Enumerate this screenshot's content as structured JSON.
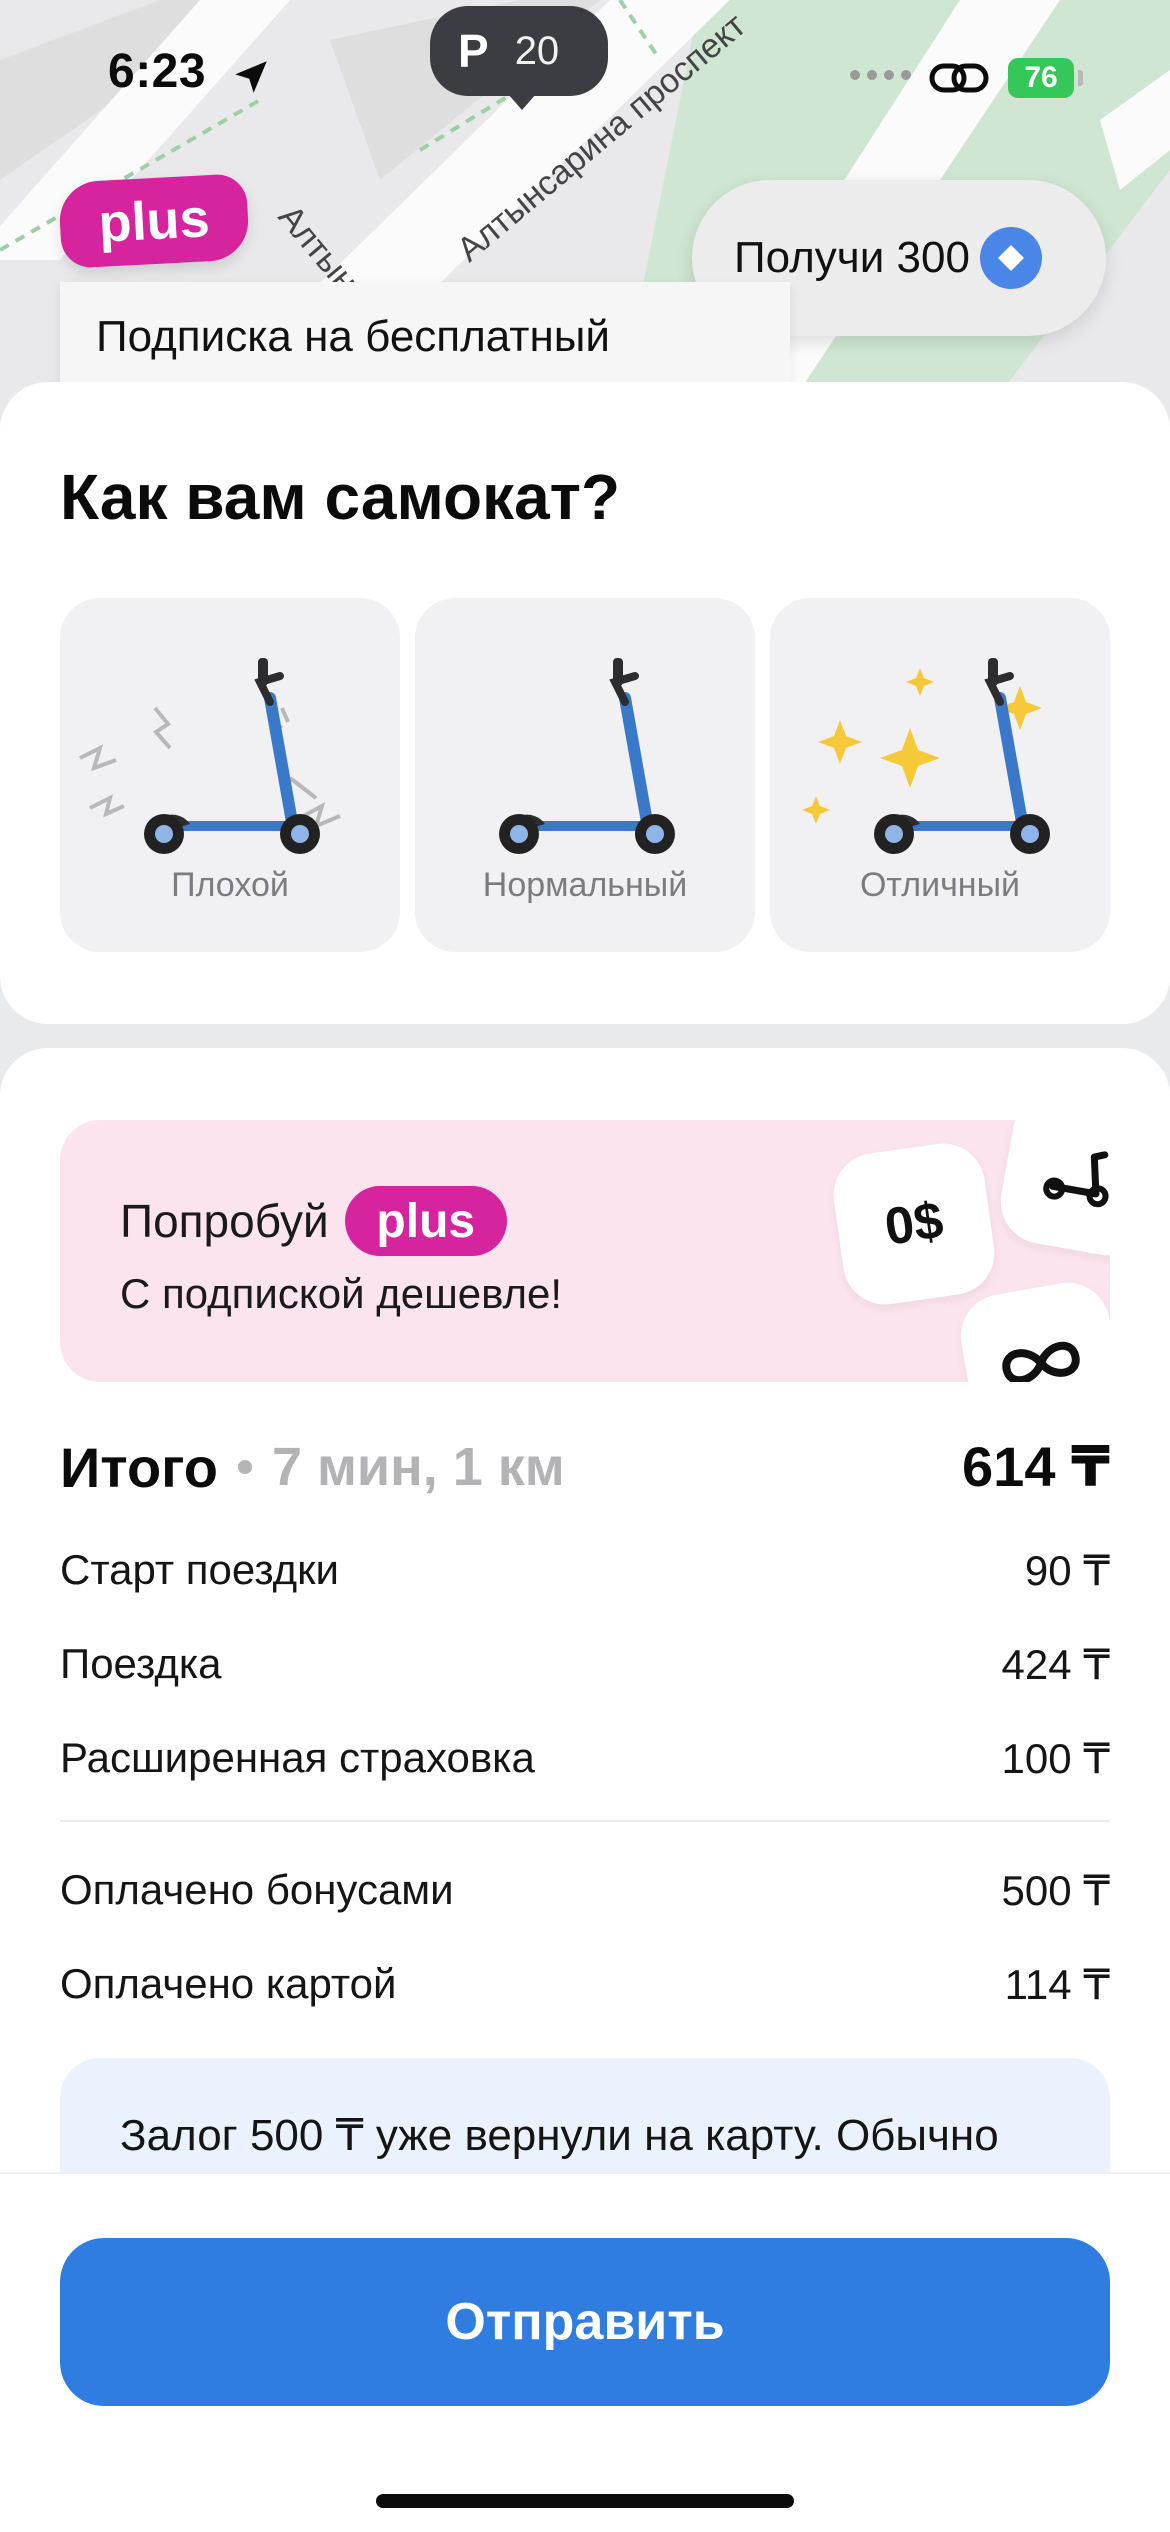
{
  "status_bar": {
    "time": "6:23",
    "parking_letter": "P",
    "parking_count": "20",
    "battery": "76"
  },
  "map": {
    "street_label": "Алтынсарина проспект",
    "street_label_left": "Алтын",
    "plus_badge": "plus",
    "get_bonus_label": "Получи 300",
    "promo_banner": "Подписка на бесплатный"
  },
  "rating": {
    "title": "Как вам самокат?",
    "options": [
      {
        "label": "Плохой",
        "icon": "scooter-bad-icon"
      },
      {
        "label": "Нормальный",
        "icon": "scooter-normal-icon"
      },
      {
        "label": "Отличный",
        "icon": "scooter-great-icon"
      }
    ]
  },
  "plus_promo": {
    "try_label": "Попробуй",
    "plus_label": "plus",
    "subtitle": "С подпиской дешевле!",
    "zero_label": "0$"
  },
  "summary": {
    "total_label": "Итого",
    "total_meta": "7 мин, 1 км",
    "total_amount": "614 ₸",
    "lines": [
      {
        "label": "Старт поездки",
        "amount": "90 ₸"
      },
      {
        "label": "Поездка",
        "amount": "424 ₸"
      },
      {
        "label": "Расширенная страховка",
        "amount": "100 ₸"
      }
    ],
    "payments": [
      {
        "label": "Оплачено бонусами",
        "amount": "500 ₸"
      },
      {
        "label": "Оплачено картой",
        "amount": "114 ₸"
      }
    ],
    "deposit_note": "Залог 500 ₸ уже вернули на карту.  Обычно"
  },
  "actions": {
    "send_label": "Отправить"
  },
  "colors": {
    "plus_pink": "#d6249f",
    "primary_blue": "#2f7de1",
    "promo_bg": "#fce4ef",
    "deposit_bg": "#eaf2fd",
    "battery_green": "#35c759"
  }
}
